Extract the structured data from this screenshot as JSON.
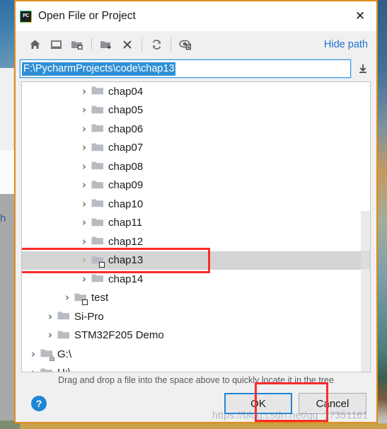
{
  "window": {
    "title": "Open File or Project",
    "app_icon_label": "PC",
    "close_label": "✕"
  },
  "toolbar": {
    "buttons": [
      {
        "name": "home-icon",
        "tooltip": "Home"
      },
      {
        "name": "desktop-icon",
        "tooltip": "Desktop"
      },
      {
        "name": "project-folder-icon",
        "tooltip": "Project Directory"
      },
      {
        "name": "new-folder-icon",
        "tooltip": "New Folder"
      },
      {
        "name": "delete-icon",
        "tooltip": "Delete"
      },
      {
        "name": "refresh-icon",
        "tooltip": "Refresh"
      },
      {
        "name": "show-hidden-files-icon",
        "tooltip": "Show Hidden Files"
      }
    ],
    "hide_path_label": "Hide path"
  },
  "path_field": {
    "value": "F:\\PycharmProjects\\code\\chap13",
    "placeholder": "",
    "selected": true,
    "dropdown_icon": "download-arrow-icon"
  },
  "tree": {
    "rows": [
      {
        "label": "chap04",
        "indent": 3,
        "chevron": true,
        "badge": "none"
      },
      {
        "label": "chap05",
        "indent": 3,
        "chevron": true,
        "badge": "none"
      },
      {
        "label": "chap06",
        "indent": 3,
        "chevron": true,
        "badge": "none"
      },
      {
        "label": "chap07",
        "indent": 3,
        "chevron": true,
        "badge": "none"
      },
      {
        "label": "chap08",
        "indent": 3,
        "chevron": true,
        "badge": "none"
      },
      {
        "label": "chap09",
        "indent": 3,
        "chevron": true,
        "badge": "none"
      },
      {
        "label": "chap10",
        "indent": 3,
        "chevron": true,
        "badge": "none"
      },
      {
        "label": "chap11",
        "indent": 3,
        "chevron": true,
        "badge": "none"
      },
      {
        "label": "chap12",
        "indent": 3,
        "chevron": true,
        "badge": "none"
      },
      {
        "label": "chap13",
        "indent": 3,
        "chevron": true,
        "badge": "module",
        "selected": true
      },
      {
        "label": "chap14",
        "indent": 3,
        "chevron": true,
        "badge": "none"
      },
      {
        "label": "test",
        "indent": 2,
        "chevron": true,
        "badge": "module"
      },
      {
        "label": "Si-Pro",
        "indent": 1,
        "chevron": true,
        "badge": "none"
      },
      {
        "label": "STM32F205 Demo",
        "indent": 1,
        "chevron": true,
        "badge": "none"
      },
      {
        "label": "G:\\",
        "indent": 0,
        "chevron": true,
        "badge": "lock"
      },
      {
        "label": "H:\\",
        "indent": 0,
        "chevron": true,
        "badge": "lock"
      }
    ],
    "selected_label": "chap13",
    "chevron_glyph": "›"
  },
  "footer": {
    "hint": "Drag and drop a file into the space above to quickly locate it in the tree",
    "help_label": "?",
    "ok_label": "OK",
    "cancel_label": "Cancel"
  },
  "annotations": {
    "watermark": "https://blog.csdn.net/qq_17351161",
    "highlight_color": "#fb2b2b"
  },
  "desktop": {
    "background_letter": "h"
  }
}
